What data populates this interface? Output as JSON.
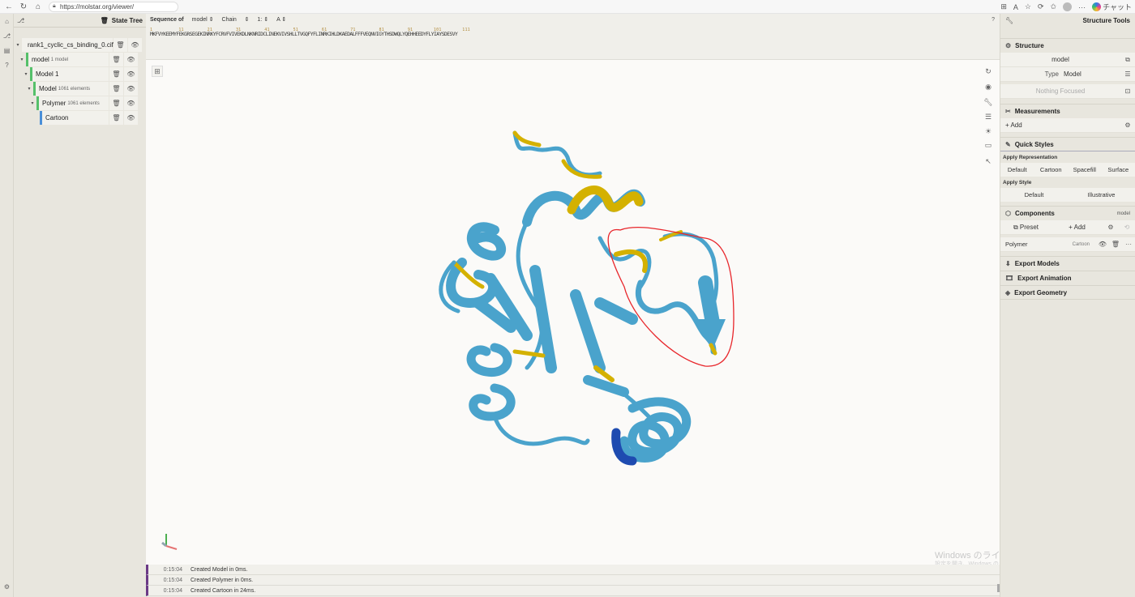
{
  "browser": {
    "url": "https://molstar.org/viewer/",
    "chat_label": "チャット"
  },
  "state_tree": {
    "title": "State Tree",
    "nodes": [
      {
        "label": "rank1_cyclic_cs_binding_0.cif",
        "sub": ""
      },
      {
        "label": "model",
        "sub": "1 model"
      },
      {
        "label": "Model 1",
        "sub": ""
      },
      {
        "label": "Model",
        "sub": "1061 elements"
      },
      {
        "label": "Polymer",
        "sub": "1061 elements"
      },
      {
        "label": "Cartoon",
        "sub": ""
      }
    ]
  },
  "sequence": {
    "label": "Sequence of",
    "entity": "model",
    "mode": "Chain",
    "chain_index": "1:",
    "chain_id": "A",
    "numbers": "1          11         21         31         41         51         61         71         81         91        101        111",
    "residues": "MKFVYKEEMYFEKGRSEGEKINRKYFCRVFVIVEKDLNKNRIDCLINEKVIVSHLLTVGQFYFLINRKIHLDKAEDALFFFVEQNVIGYTHSDWQLYQEHHEEDYFLYIAYSDESVY"
  },
  "log": [
    {
      "time": "0:15:04",
      "message": "Created Model in 0ms."
    },
    {
      "time": "0:15:04",
      "message": "Created Polymer in 0ms."
    },
    {
      "time": "0:15:04",
      "message": "Created Cartoon in 24ms."
    }
  ],
  "watermark": {
    "line1": "Windows のライセンス認証",
    "line2": "設定を開き、Windows のライセンス認証を行ってください。"
  },
  "structure_tools": {
    "title": "Structure Tools",
    "structure": {
      "title": "Structure",
      "model_value": "model",
      "type_label": "Type",
      "type_value": "Model",
      "focus_placeholder": "Nothing Focused"
    },
    "measurements": {
      "title": "Measurements",
      "add_label": "Add"
    },
    "quick_styles": {
      "title": "Quick Styles",
      "apply_representation": "Apply Representation",
      "representations": [
        "Default",
        "Cartoon",
        "Spacefill",
        "Surface"
      ],
      "apply_style": "Apply Style",
      "styles": [
        "Default",
        "Illustrative"
      ]
    },
    "components": {
      "title": "Components",
      "note": "model",
      "preset_label": "Preset",
      "add_label": "Add",
      "polymer_label": "Polymer",
      "polymer_repr": "Cartoon"
    },
    "export_models": "Export Models",
    "export_animation": "Export Animation",
    "export_geometry": "Export Geometry"
  },
  "colors": {
    "helix_strand": "#4aa3cc",
    "loop_highlight": "#d4b100",
    "annotation_circle": "#e8262b",
    "log_accent": "#6b3a86"
  }
}
